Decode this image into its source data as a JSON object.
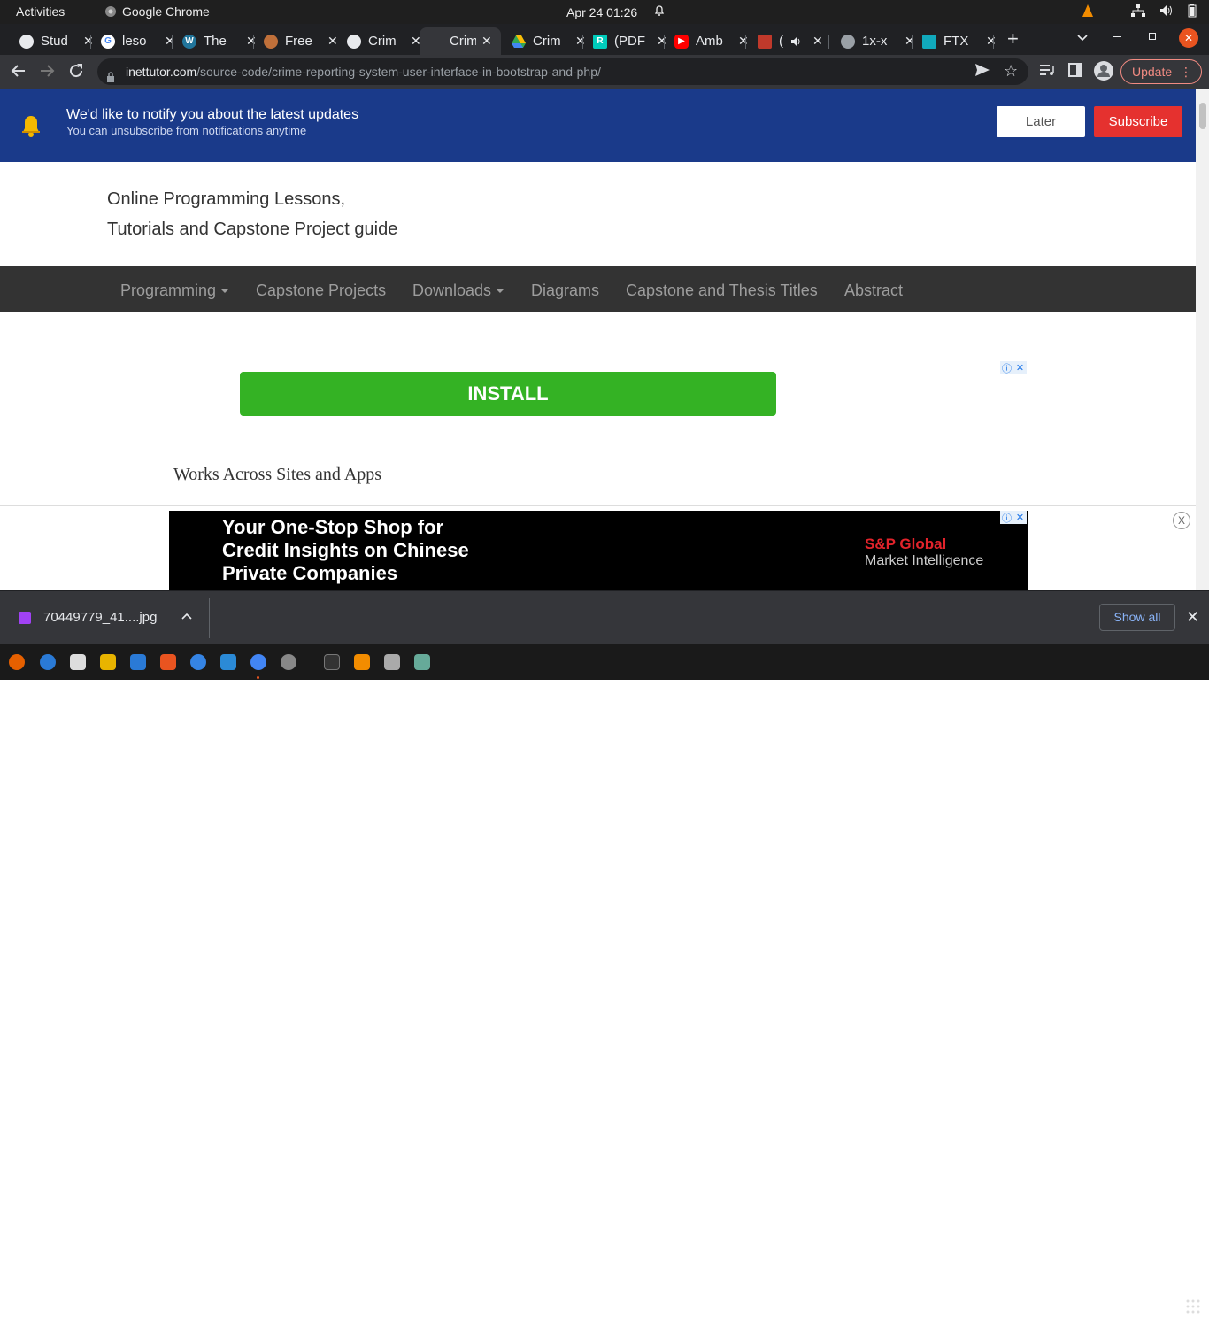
{
  "topbar": {
    "activities": "Activities",
    "app_name": "Google Chrome",
    "clock": "Apr 24  01:26"
  },
  "tabs": [
    {
      "title": "Stud",
      "favicon": "globe-icon",
      "color": "#e8eaed"
    },
    {
      "title": "leso",
      "favicon": "google-icon",
      "color": "#4285f4"
    },
    {
      "title": "The",
      "favicon": "wordpress-icon",
      "color": "#21759b"
    },
    {
      "title": "Free",
      "favicon": "site-icon",
      "color": "#c0703a"
    },
    {
      "title": "Crim",
      "favicon": "globe-icon",
      "color": "#e8eaed"
    },
    {
      "title": "Crim",
      "favicon": "blank-icon",
      "color": "#35363a"
    },
    {
      "title": "Crim",
      "favicon": "drive-icon",
      "color": "#34a853"
    },
    {
      "title": "(PDF",
      "favicon": "researchgate-icon",
      "color": "#00ccbb"
    },
    {
      "title": "Amb",
      "favicon": "youtube-icon",
      "color": "#ff0000"
    },
    {
      "title": "(",
      "favicon": "site-icon",
      "color": "#c0392b"
    },
    {
      "title": "1x-x",
      "favicon": "globe-icon",
      "color": "#9aa0a6"
    },
    {
      "title": "FTX",
      "favicon": "ftx-icon",
      "color": "#11a9bc"
    }
  ],
  "omnibox": {
    "host": "inettutor.com",
    "path": "/source-code/crime-reporting-system-user-interface-in-bootstrap-and-php/"
  },
  "toolbar": {
    "update_label": "Update"
  },
  "notification": {
    "title": "We'd like to notify you about the latest updates",
    "subtitle": "You can unsubscribe from notifications anytime",
    "later_label": "Later",
    "subscribe_label": "Subscribe"
  },
  "site": {
    "tagline_line1": "Online Programming Lessons,",
    "tagline_line2": "Tutorials and Capstone Project guide"
  },
  "nav": {
    "items": [
      {
        "label": "Programming",
        "dropdown": true
      },
      {
        "label": "Capstone Projects",
        "dropdown": false
      },
      {
        "label": "Downloads",
        "dropdown": true
      },
      {
        "label": "Diagrams",
        "dropdown": false
      },
      {
        "label": "Capstone and Thesis Titles",
        "dropdown": false
      },
      {
        "label": "Abstract",
        "dropdown": false
      }
    ]
  },
  "ads": {
    "install_label": "INSTALL",
    "works_text": "Works Across Sites and Apps",
    "banner_line1": "Your One-Stop Shop for",
    "banner_line2": "Credit Insights on Chinese",
    "banner_line3": "Private Companies",
    "brand_line1": "S&P Global",
    "brand_line2": "Market Intelligence",
    "close_label": "X"
  },
  "download": {
    "filename": "70449779_41....jpg",
    "show_all_label": "Show all"
  }
}
